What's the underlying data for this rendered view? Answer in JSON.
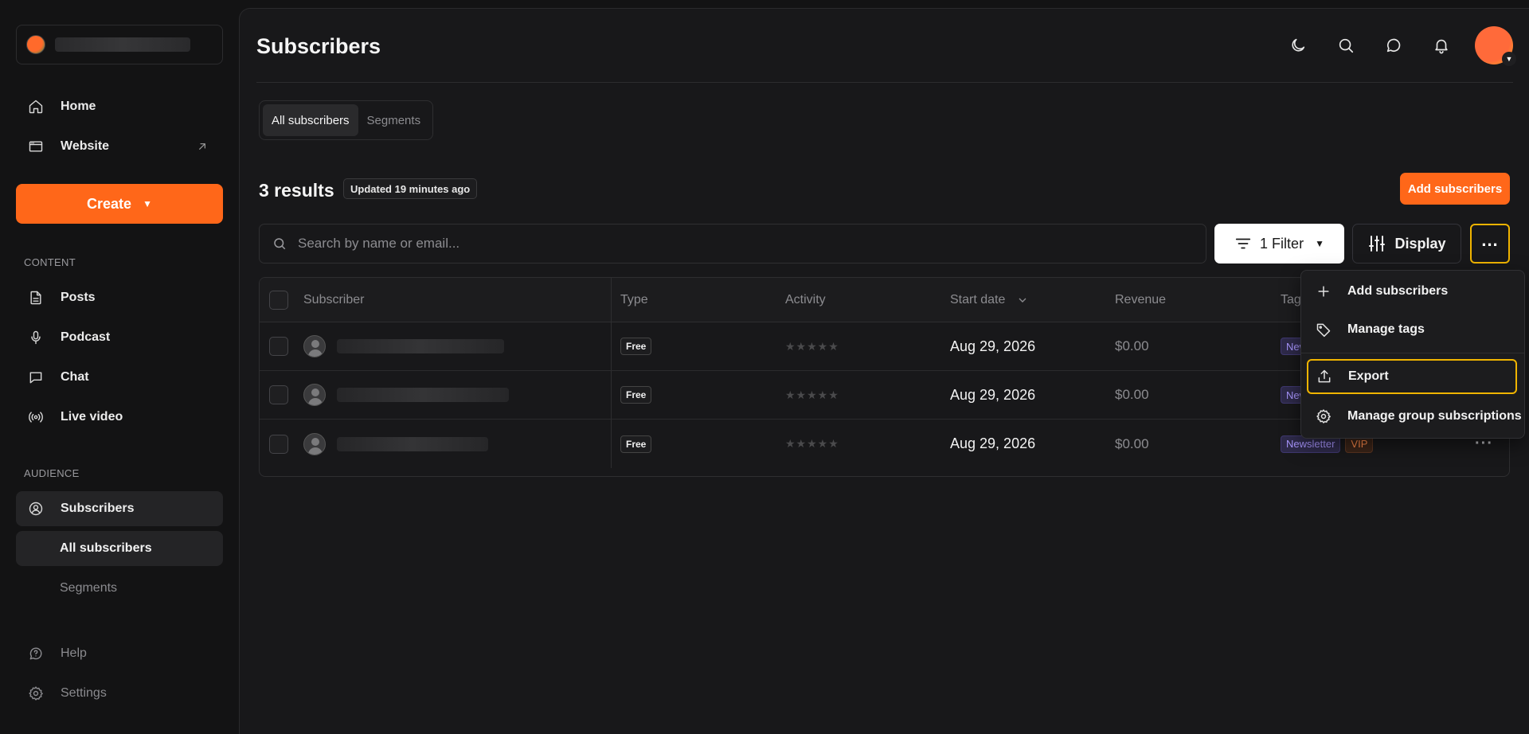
{
  "sidebar": {
    "nav": [
      {
        "label": "Home",
        "icon": "home-icon"
      },
      {
        "label": "Website",
        "icon": "browser-window-icon"
      }
    ],
    "create_label": "Create",
    "sections": {
      "content": "CONTENT",
      "audience": "AUDIENCE"
    },
    "content_items": [
      {
        "label": "Posts",
        "icon": "document-icon"
      },
      {
        "label": "Podcast",
        "icon": "microphone-icon"
      },
      {
        "label": "Chat",
        "icon": "chat-bubble-icon"
      },
      {
        "label": "Live video",
        "icon": "broadcast-icon"
      }
    ],
    "audience_items": [
      {
        "label": "Subscribers",
        "icon": "user-circle-icon"
      },
      {
        "label": "All subscribers"
      },
      {
        "label": "Segments"
      }
    ],
    "footer_items": [
      {
        "label": "Help",
        "icon": "help-icon"
      },
      {
        "label": "Settings",
        "icon": "gear-icon"
      }
    ]
  },
  "header": {
    "title": "Subscribers"
  },
  "tabs": [
    {
      "label": "All subscribers",
      "active": true
    },
    {
      "label": "Segments",
      "active": false
    }
  ],
  "results": {
    "count_label": "3 results",
    "updated_label": "Updated 19 minutes ago"
  },
  "toolbar": {
    "add_subscribers_label": "Add subscribers",
    "search_placeholder": "Search by name or email...",
    "filter_label": "1 Filter",
    "display_label": "Display"
  },
  "table": {
    "columns": [
      "Subscriber",
      "Type",
      "Activity",
      "Start date",
      "Revenue",
      "Tags"
    ],
    "rows": [
      {
        "type": "Free",
        "stars": "★★★★★",
        "start_date": "Aug 29, 2026",
        "revenue": "$0.00",
        "tags": [
          "Newsletter"
        ]
      },
      {
        "type": "Free",
        "stars": "★★★★★",
        "start_date": "Aug 29, 2026",
        "revenue": "$0.00",
        "tags": [
          "Newsletter"
        ]
      },
      {
        "type": "Free",
        "stars": "★★★★★",
        "start_date": "Aug 29, 2026",
        "revenue": "$0.00",
        "tags": [
          "Newsletter",
          "VIP"
        ]
      }
    ]
  },
  "menu": {
    "items": [
      {
        "label": "Add subscribers",
        "icon": "plus-icon"
      },
      {
        "label": "Manage tags",
        "icon": "tag-icon"
      },
      {
        "label": "Export",
        "icon": "upload-icon"
      },
      {
        "label": "Manage group subscriptions",
        "icon": "gear-icon"
      }
    ]
  },
  "colors": {
    "accent": "#ff6719",
    "highlight": "#f0b400",
    "background": "#18181a"
  }
}
